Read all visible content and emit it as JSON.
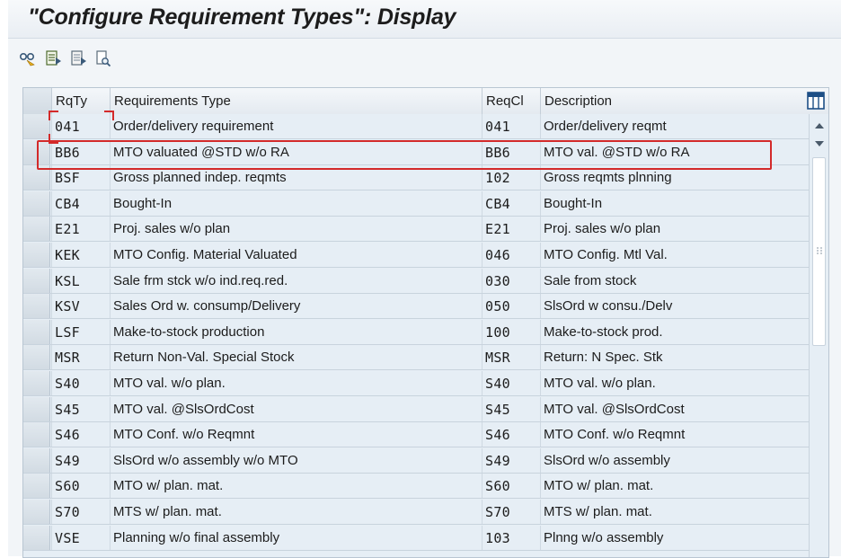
{
  "window": {
    "title": "\"Configure Requirement Types\": Display"
  },
  "toolbar": {
    "buttons": [
      {
        "icon": "glasses-display-icon"
      },
      {
        "icon": "select-all-icon"
      },
      {
        "icon": "deselect-all-icon"
      },
      {
        "icon": "print-preview-icon"
      }
    ]
  },
  "table": {
    "columns": [
      "RqTy",
      "Requirements Type",
      "ReqCl",
      "Description"
    ],
    "rows": [
      {
        "rqty": "041",
        "type": "Order/delivery requirement",
        "reqcl": "041",
        "desc": "Order/delivery reqmt"
      },
      {
        "rqty": "BB6",
        "type": "MTO valuated @STD w/o RA",
        "reqcl": "BB6",
        "desc": "MTO val. @STD w/o RA"
      },
      {
        "rqty": "BSF",
        "type": "Gross planned indep. reqmts",
        "reqcl": "102",
        "desc": "Gross reqmts plnning"
      },
      {
        "rqty": "CB4",
        "type": "Bought-In",
        "reqcl": "CB4",
        "desc": "Bought-In"
      },
      {
        "rqty": "E21",
        "type": "Proj. sales w/o plan",
        "reqcl": "E21",
        "desc": "Proj. sales w/o plan"
      },
      {
        "rqty": "KEK",
        "type": "MTO Config. Material Valuated",
        "reqcl": "046",
        "desc": "MTO Config. Mtl Val."
      },
      {
        "rqty": "KSL",
        "type": "Sale frm stck w/o ind.req.red.",
        "reqcl": "030",
        "desc": "Sale from stock"
      },
      {
        "rqty": "KSV",
        "type": "Sales Ord w. consump/Delivery",
        "reqcl": "050",
        "desc": "SlsOrd w consu./Delv"
      },
      {
        "rqty": "LSF",
        "type": "Make-to-stock production",
        "reqcl": "100",
        "desc": "Make-to-stock prod."
      },
      {
        "rqty": "MSR",
        "type": "Return Non-Val. Special Stock",
        "reqcl": "MSR",
        "desc": "Return: N Spec. Stk"
      },
      {
        "rqty": "S40",
        "type": "MTO val. w/o plan.",
        "reqcl": "S40",
        "desc": "MTO val. w/o plan."
      },
      {
        "rqty": "S45",
        "type": "MTO val. @SlsOrdCost",
        "reqcl": "S45",
        "desc": "MTO val. @SlsOrdCost"
      },
      {
        "rqty": "S46",
        "type": "MTO Conf. w/o Reqmnt",
        "reqcl": "S46",
        "desc": "MTO Conf. w/o Reqmnt"
      },
      {
        "rqty": "S49",
        "type": "SlsOrd w/o assembly w/o MTO",
        "reqcl": "S49",
        "desc": "SlsOrd w/o assembly"
      },
      {
        "rqty": "S60",
        "type": "MTO w/ plan. mat.",
        "reqcl": "S60",
        "desc": "MTO w/ plan. mat."
      },
      {
        "rqty": "S70",
        "type": "MTS w/ plan. mat.",
        "reqcl": "S70",
        "desc": "MTS w/ plan. mat."
      },
      {
        "rqty": "VSE",
        "type": "Planning w/o final assembly",
        "reqcl": "103",
        "desc": "Plnng w/o assembly"
      }
    ]
  },
  "colors": {
    "highlight": "#d32a2a",
    "row_bg": "#e6eef5",
    "grid": "#c8d3dd"
  }
}
